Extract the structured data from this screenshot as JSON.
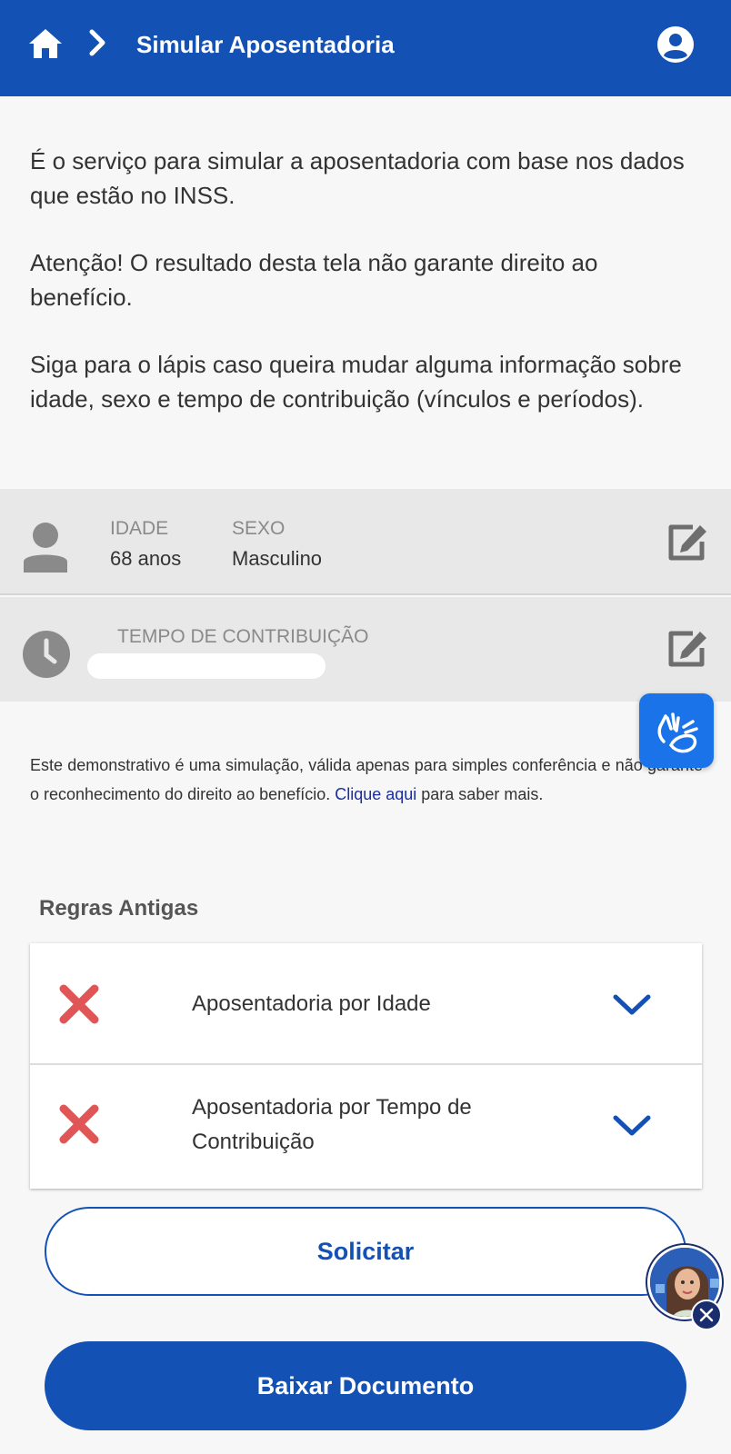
{
  "header": {
    "title": "Simular Aposentadoria",
    "icons": [
      "home-icon",
      "chevron-right-icon",
      "user-account-icon"
    ]
  },
  "intro": {
    "paragraph1": "É o serviço para simular a aposentadoria com base nos dados que estão no INSS.",
    "paragraph2": "Atenção! O resultado desta tela não garante direito ao benefício.",
    "paragraph3": "Siga para o lápis caso queira mudar alguma informação sobre idade, sexo e tempo de contribuição (vínculos e períodos)."
  },
  "profile": {
    "age_label": "IDADE",
    "age_value": "68 anos",
    "sex_label": "SEXO",
    "sex_value": "Masculino",
    "contribution_label": "TEMPO DE CONTRIBUIÇÃO"
  },
  "disclaimer": {
    "text_before": "Este demonstrativo é uma simulação, válida apenas para simples conferência e não garante o reconhecimento do direito ao benefício. ",
    "link": "Clique aqui",
    "text_after": " para saber mais."
  },
  "rules": {
    "section_title": "Regras Antigas",
    "items": [
      {
        "label": "Aposentadoria por Idade",
        "status": "not-eligible"
      },
      {
        "label": "Aposentadoria por Tempo de Contribuição",
        "status": "not-eligible"
      }
    ]
  },
  "actions": {
    "request_label": "Solicitar",
    "download_label": "Baixar Documento"
  },
  "colors": {
    "primary": "#1351b4",
    "error_red": "#e05555",
    "libras_blue": "#1a73e8"
  }
}
